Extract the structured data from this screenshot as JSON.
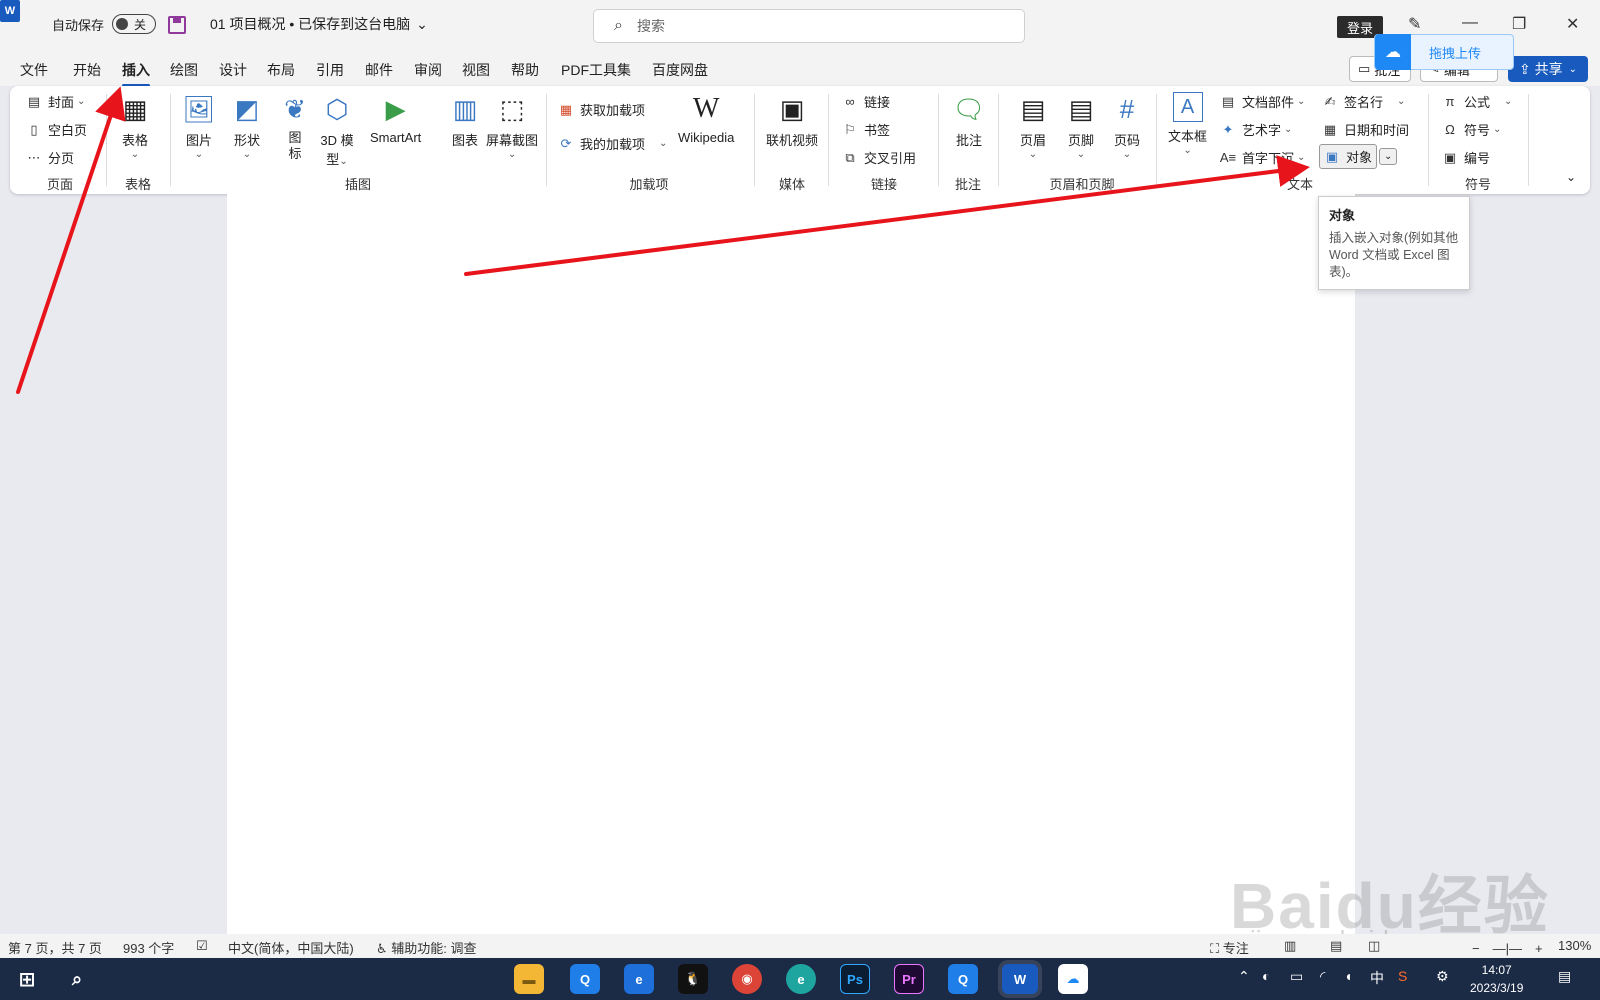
{
  "titlebar": {
    "app_icon": "W",
    "autosave_label": "自动保存",
    "autosave_state": "关",
    "doc_title": "01 项目概况 • 已保存到这台电脑",
    "search_placeholder": "搜索",
    "login_label": "登录",
    "pen_icon": "pen-icon"
  },
  "baidu_float": {
    "label": "拖拽上传"
  },
  "menu": {
    "items": [
      "文件",
      "开始",
      "插入",
      "绘图",
      "设计",
      "布局",
      "引用",
      "邮件",
      "审阅",
      "视图",
      "帮助",
      "PDF工具集",
      "百度网盘"
    ],
    "active": "插入",
    "comment_btn": "批注",
    "edit_btn": "编辑",
    "share_btn": "共享"
  },
  "ribbon": {
    "page": {
      "label": "页面",
      "cover": "封面",
      "blank": "空白页",
      "break": "分页"
    },
    "table": {
      "label": "表格",
      "btn": "表格"
    },
    "illustrations": {
      "label": "插图",
      "picture": "图片",
      "shapes": "形状",
      "icons": "图标",
      "model3d_a": "3D 模",
      "model3d_b": "型",
      "smartart": "SmartArt",
      "chart": "图表",
      "screenshot": "屏幕截图"
    },
    "addins": {
      "label": "加载项",
      "get": "获取加载项",
      "mine": "我的加载项",
      "wikipedia": "Wikipedia"
    },
    "media": {
      "label": "媒体",
      "video": "联机视频"
    },
    "links": {
      "label": "链接",
      "link": "链接",
      "bookmark": "书签",
      "cross_ref": "交叉引用"
    },
    "comments": {
      "label": "批注",
      "btn": "批注"
    },
    "header_footer": {
      "label": "页眉和页脚",
      "header": "页眉",
      "footer": "页脚",
      "page_num": "页码"
    },
    "text": {
      "label": "文本",
      "textbox": "文本框",
      "quick_parts": "文档部件",
      "wordart": "艺术字",
      "dropcap": "首字下沉",
      "signature": "签名行",
      "datetime": "日期和时间",
      "object": "对象"
    },
    "symbols": {
      "label": "符号",
      "equation": "公式",
      "symbol": "符号",
      "number": "编号"
    }
  },
  "tooltip": {
    "title": "对象",
    "body": "插入嵌入对象(例如其他 Word 文档或 Excel 图表)。"
  },
  "statusbar": {
    "page": "第 7 页，共 7 页",
    "words": "993 个字",
    "language": "中文(简体，中国大陆)",
    "accessibility": "辅助功能: 调查",
    "focus": "专注",
    "zoom": "130%"
  },
  "taskbar": {
    "apps": [
      "file-explorer",
      "qq-browser",
      "edge-legacy",
      "qq",
      "chrome",
      "edge",
      "Ps",
      "Pr",
      "qq-browser-2",
      "W",
      "baidu-netdisk"
    ],
    "ime": "中",
    "time": "14:07",
    "date": "2023/3/19"
  },
  "watermark": {
    "brand": "Baidu经验",
    "url": "jingyan.baidu.com"
  },
  "colors": {
    "accent": "#185abd",
    "arrow": "#e8141b",
    "taskbar": "#1b2a45"
  }
}
